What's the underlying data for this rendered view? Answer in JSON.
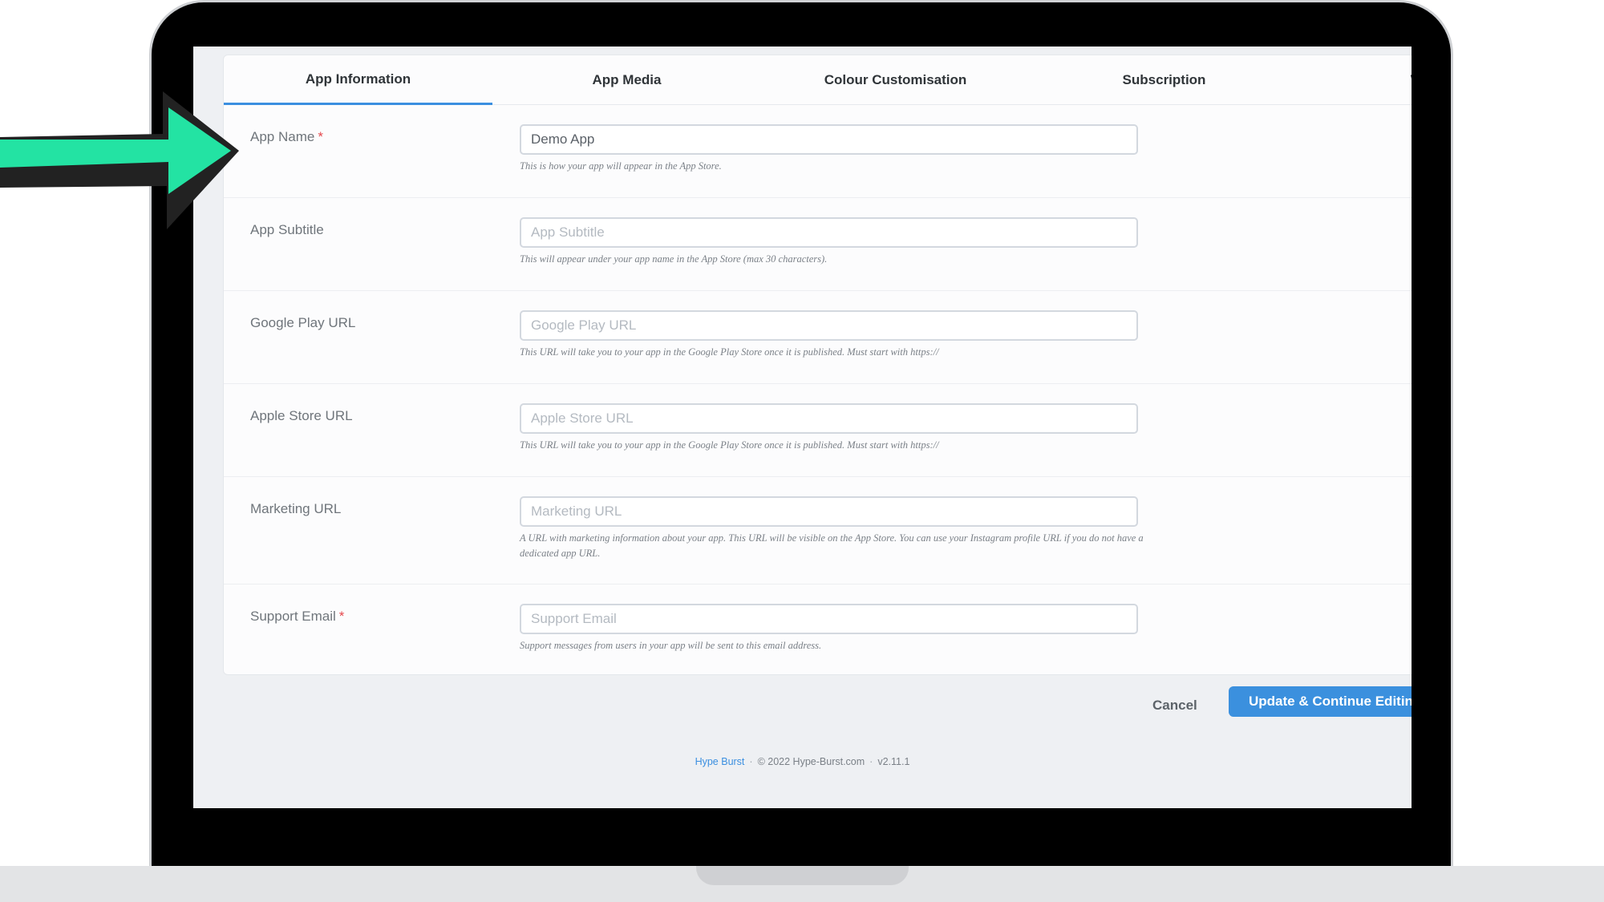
{
  "tabs": [
    {
      "label": "App Information",
      "active": true
    },
    {
      "label": "App Media",
      "active": false
    },
    {
      "label": "Colour Customisation",
      "active": false
    },
    {
      "label": "Subscription",
      "active": false
    },
    {
      "label": "Websit",
      "active": false
    }
  ],
  "fields": {
    "app_name": {
      "label": "App Name",
      "required": "*",
      "value": "Demo App",
      "placeholder": "",
      "hint": "This is how your app will appear in the App Store."
    },
    "app_subtitle": {
      "label": "App Subtitle",
      "value": "",
      "placeholder": "App Subtitle",
      "hint": "This will appear under your app name in the App Store (max 30 characters)."
    },
    "google_play_url": {
      "label": "Google Play URL",
      "value": "",
      "placeholder": "Google Play URL",
      "hint": "This URL will take you to your app in the Google Play Store once it is published. Must start with https://"
    },
    "apple_store_url": {
      "label": "Apple Store URL",
      "value": "",
      "placeholder": "Apple Store URL",
      "hint": "This URL will take you to your app in the Google Play Store once it is published. Must start with https://"
    },
    "marketing_url": {
      "label": "Marketing URL",
      "value": "",
      "placeholder": "Marketing URL",
      "hint": "A URL with marketing information about your app. This URL will be visible on the App Store. You can use your Instagram profile URL if you do not have a dedicated app URL."
    },
    "support_email": {
      "label": "Support Email",
      "required": "*",
      "value": "",
      "placeholder": "Support Email",
      "hint": "Support messages from users in your app will be sent to this email address."
    }
  },
  "actions": {
    "cancel": "Cancel",
    "primary": "Update & Continue Editin"
  },
  "footer": {
    "brand": "Hype Burst",
    "copyright": "© 2022 Hype-Burst.com",
    "version": "v2.11.1",
    "separator": "·"
  },
  "colors": {
    "accent": "#3b90de",
    "arrow_fill": "#23e3a3",
    "arrow_outline": "#222222",
    "required": "#e5484d"
  },
  "icons": {
    "annotation": "arrow-right-icon"
  }
}
